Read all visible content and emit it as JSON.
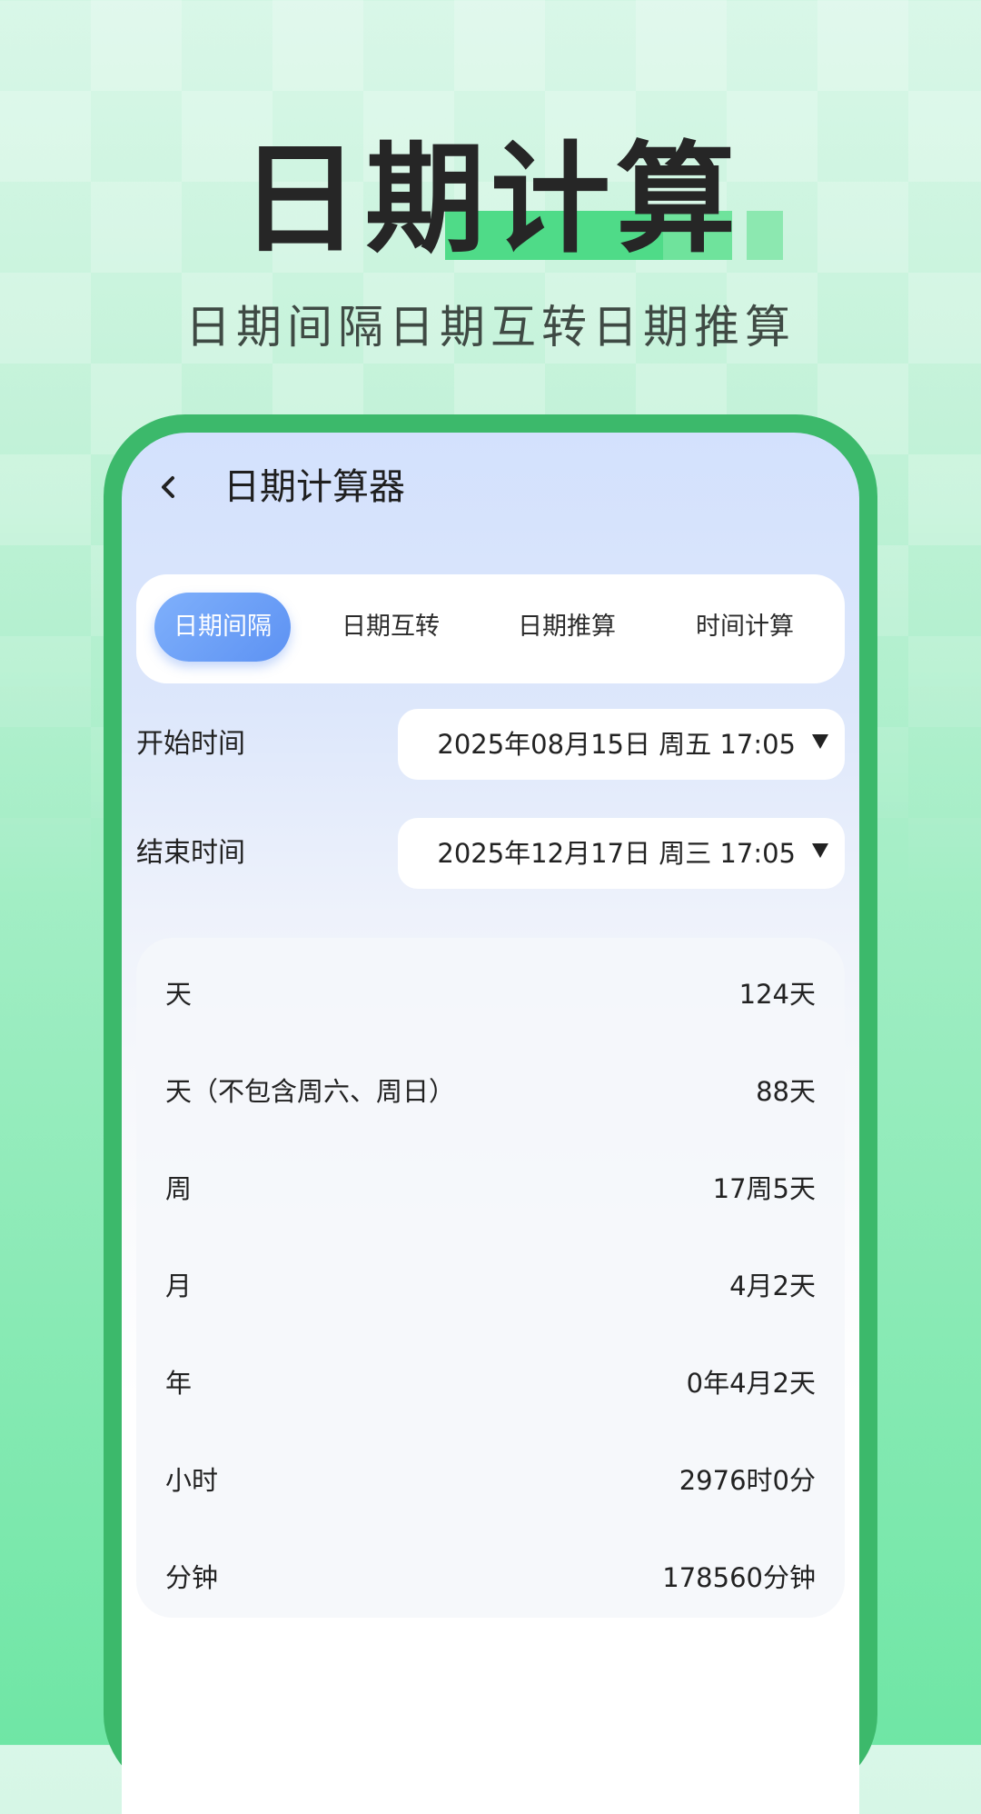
{
  "hero": {
    "title": "日期计算",
    "subtitle": "日期间隔日期互转日期推算"
  },
  "nav": {
    "back_icon": "chevron-left-icon",
    "title": "日期计算器"
  },
  "tabs": [
    {
      "label": "日期间隔",
      "active": true
    },
    {
      "label": "日期互转",
      "active": false
    },
    {
      "label": "日期推算",
      "active": false
    },
    {
      "label": "时间计算",
      "active": false
    }
  ],
  "fields": {
    "start": {
      "label": "开始时间",
      "value": "2025年08月15日 周五 17:05"
    },
    "end": {
      "label": "结束时间",
      "value": "2025年12月17日 周三 17:05"
    }
  },
  "results": [
    {
      "label": "天",
      "value": "124天"
    },
    {
      "label": "天（不包含周六、周日）",
      "value": "88天"
    },
    {
      "label": "周",
      "value": "17周5天"
    },
    {
      "label": "月",
      "value": "4月2天"
    },
    {
      "label": "年",
      "value": "0年4月2天"
    },
    {
      "label": "小时",
      "value": "2976时0分"
    },
    {
      "label": "分钟",
      "value": "178560分钟"
    }
  ],
  "colors": {
    "frame": "#3cb96b",
    "active_tab": "#6a9ff6",
    "highlight": "#4fdb88"
  }
}
